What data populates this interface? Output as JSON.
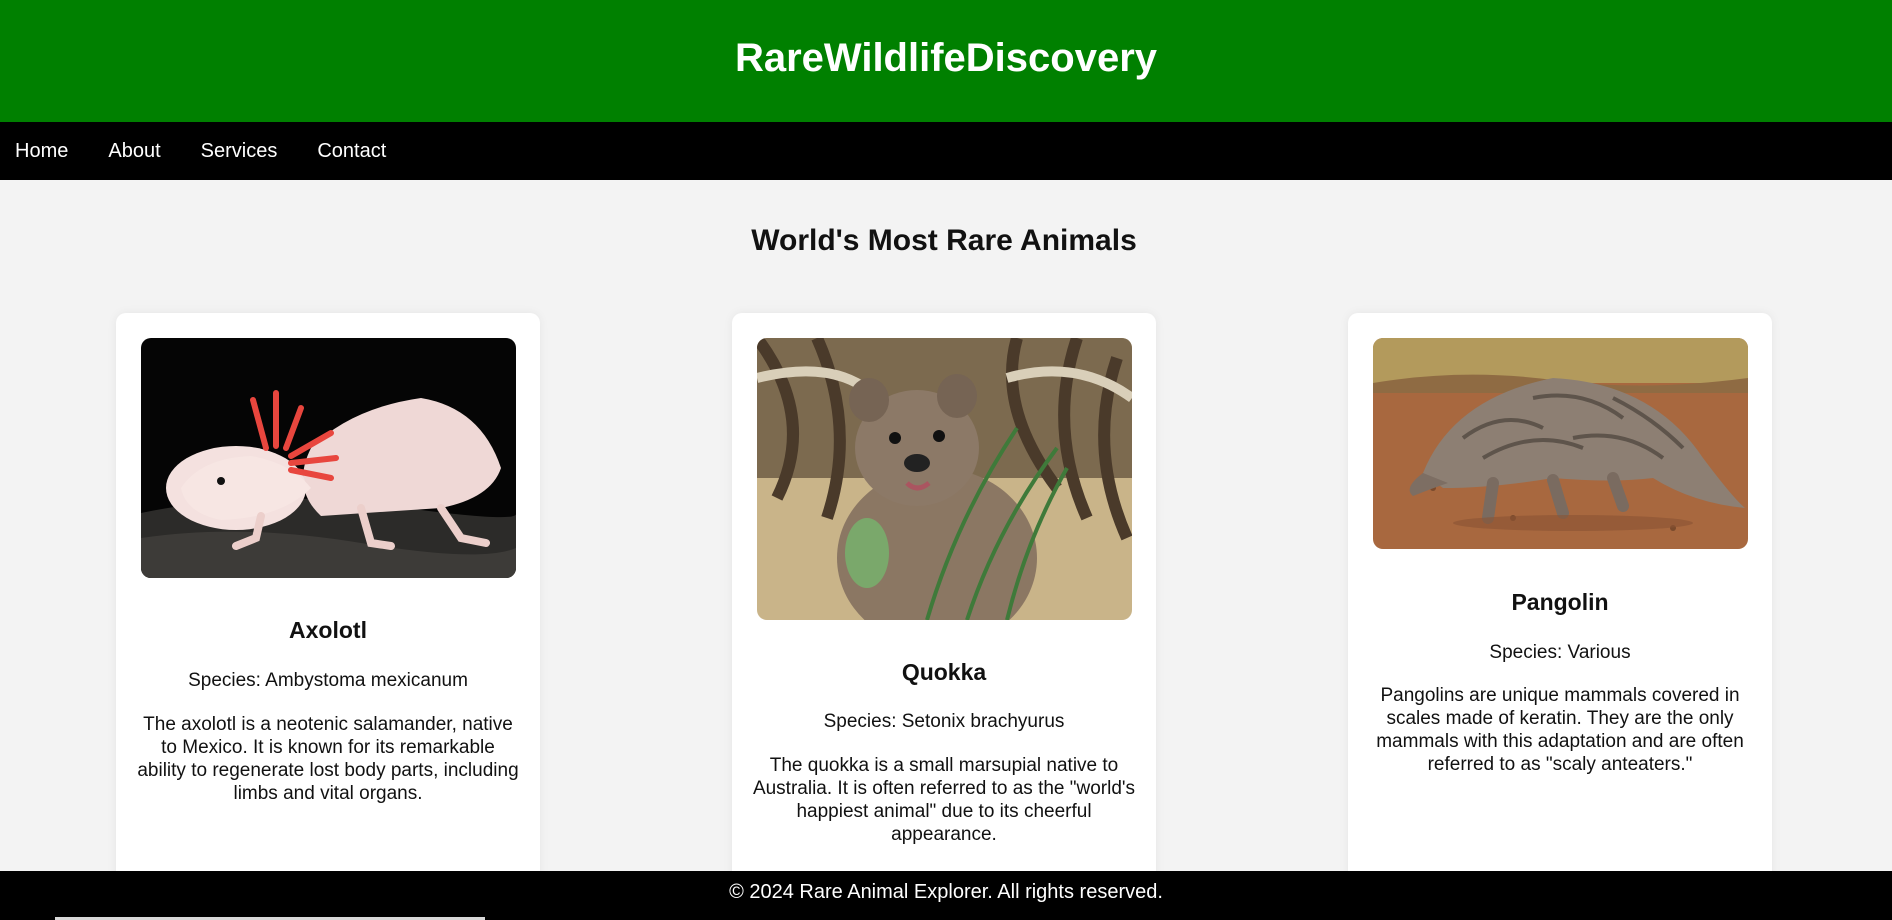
{
  "header": {
    "title": "RareWildlifeDiscovery"
  },
  "nav": {
    "items": [
      "Home",
      "About",
      "Services",
      "Contact"
    ]
  },
  "main": {
    "title": "World's Most Rare Animals",
    "cards": [
      {
        "name": "Axolotl",
        "species": "Species: Ambystoma mexicanum",
        "description": "The axolotl is a neotenic salamander, native to Mexico. It is known for its remarkable ability to regenerate lost body parts, including limbs and vital organs.",
        "image_icon": "axolotl-photo"
      },
      {
        "name": "Quokka",
        "species": "Species: Setonix brachyurus",
        "description": "The quokka is a small marsupial native to Australia. It is often referred to as the \"world's happiest animal\" due to its cheerful appearance.",
        "image_icon": "quokka-photo"
      },
      {
        "name": "Pangolin",
        "species": "Species: Various",
        "description": "Pangolins are unique mammals covered in scales made of keratin. They are the only mammals with this adaptation and are often referred to as \"scaly anteaters.\"",
        "image_icon": "pangolin-photo"
      }
    ]
  },
  "footer": {
    "text": "© 2024 Rare Animal Explorer. All rights reserved."
  },
  "colors": {
    "header_bg": "#008000",
    "nav_bg": "#000000",
    "page_bg": "#f3f3f3",
    "card_bg": "#ffffff"
  }
}
